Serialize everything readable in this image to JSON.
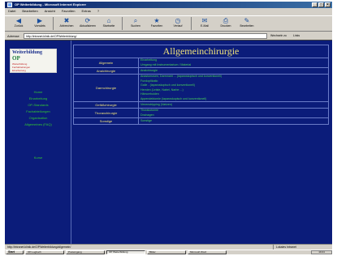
{
  "window": {
    "title": "OP Weiterbildung - Microsoft Internet Explorer",
    "min_glyph": "_",
    "max_glyph": "□",
    "close_glyph": "×"
  },
  "menu": [
    "Datei",
    "Bearbeiten",
    "Ansicht",
    "Favoriten",
    "Extras",
    "?"
  ],
  "toolbar": [
    {
      "label": "Zurück",
      "icon": "back-icon",
      "glyph": "◀"
    },
    {
      "label": "Vorwärts",
      "icon": "forward-icon",
      "glyph": "▶"
    },
    {
      "label": "Abbrechen",
      "icon": "stop-icon",
      "glyph": "✖"
    },
    {
      "label": "Aktualisieren",
      "icon": "refresh-icon",
      "glyph": "⟳"
    },
    {
      "label": "Startseite",
      "icon": "home-icon",
      "glyph": "⌂"
    },
    {
      "label": "Suchen",
      "icon": "search-icon",
      "glyph": "⌕"
    },
    {
      "label": "Favoriten",
      "icon": "favorites-icon",
      "glyph": "★"
    },
    {
      "label": "Verlauf",
      "icon": "history-icon",
      "glyph": "◷"
    },
    {
      "label": "E-Mail",
      "icon": "mail-icon",
      "glyph": "✉"
    },
    {
      "label": "Drucken",
      "icon": "print-icon",
      "glyph": "⎙"
    },
    {
      "label": "Bearbeiten",
      "icon": "edit-icon",
      "glyph": "✎"
    }
  ],
  "address": {
    "label": "Adresse",
    "url": "http://intranet.klinik.de/OPWeiterbildung/",
    "go": "Wechseln zu",
    "links": "Links"
  },
  "sidebar": {
    "logo_title": "Weiterbildung",
    "logo_sub": "OP",
    "logo_lines": [
      "Weiterbildung",
      "Fachabteilungen",
      "Einarbeitung"
    ],
    "links": [
      "Home",
      "Einarbeitung",
      "OP-Standards",
      "Fachabteilungen",
      "Organisation",
      "Allgemeines (FAQ)"
    ],
    "kurse": "Kurse"
  },
  "main": {
    "heading": "Allgemeinchirurgie",
    "rows": [
      {
        "category": "Allgemein",
        "items": [
          "Einarbeitung",
          "Umgang mit Instrumentarium / Material"
        ]
      },
      {
        "category": "Analchirurgie",
        "items": [
          "Analchirurgie"
        ]
      },
      {
        "category": "Darmchirurgie",
        "items": [
          "Anastomosen, Darmnaht ... (laparoskopisch und konventionell)",
          "Fundoplikatio",
          "Galle - (laparoskopisch und konventionell)",
          "Hernien (Leiste, Nabel, Narbe ...)",
          "Hämorrhoiden",
          "Appendektomie (laparoskopisch und konventionell)"
        ]
      },
      {
        "category": "Gefäßchirurgie",
        "items": [
          "Venenstripping (Varizen)"
        ]
      },
      {
        "category": "Thoraxchirurgie",
        "items": [
          "Thorakotomie",
          "Drainagen"
        ]
      },
      {
        "category": "Sonstige",
        "items": [
          "Sonstige"
        ]
      }
    ]
  },
  "status": {
    "text": "http://intranet.klinik.de/OPWeiterbildung/allgemein/",
    "zone": "Lokales Intranet"
  },
  "taskbar": {
    "start": "Start",
    "tasks": [
      "OP-Logbuch",
      "Posteingang",
      "OP Weiterbildung",
      "Bilder",
      "Microsoft Word"
    ],
    "active_index": 2,
    "clock": "10:24"
  },
  "colors": {
    "page_bg": "#0b1c7a",
    "heading": "#f0e27a",
    "link": "#47d35a",
    "border": "#6a7cc8"
  }
}
